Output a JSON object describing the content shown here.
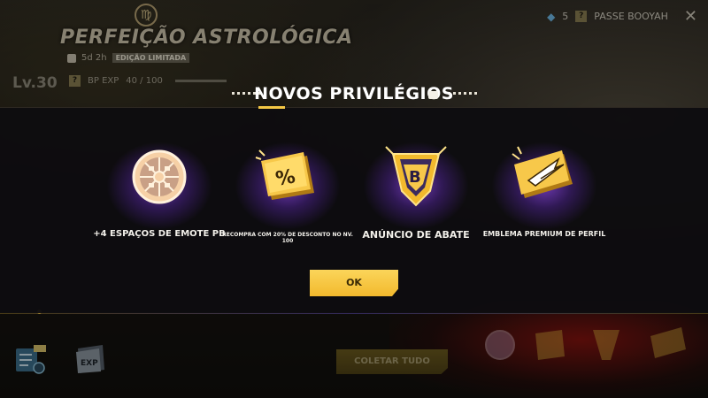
{
  "header": {
    "event_title": "PERFEIÇÃO ASTROLÓGICA",
    "zodiac_symbol": "♍",
    "timer": "5d 2h",
    "limited_tag": "EDIÇÃO LIMITADA",
    "level": "Lv.30",
    "bp_exp_label": "BP EXP",
    "bp_exp_value": "40 / 100",
    "question_badge": "?"
  },
  "top_right": {
    "diamond_count": "5",
    "pass_badge": "?",
    "pass_label": "PASSE BOOYAH",
    "close_glyph": "✕"
  },
  "modal": {
    "title": "NOVOS PRIVILÉGIOS",
    "rewards": [
      {
        "label": "+4 ESPAÇOS DE EMOTE PB",
        "icon": "emote-wheel-icon"
      },
      {
        "label": "RECOMPRA COM 20% DE DESCONTO NO NV. 100",
        "icon": "discount-ticket-icon"
      },
      {
        "label": "ANÚNCIO DE ABATE",
        "icon": "kill-announcement-badge-icon"
      },
      {
        "label": "EMBLEMA PREMIUM DE PERFIL",
        "icon": "premium-emblem-icon"
      }
    ],
    "ok_label": "OK"
  },
  "bottom": {
    "collect_all_label": "COLETAR TUDO",
    "exp_icon_text": "EXP"
  },
  "colors": {
    "accent_gold": "#f5c845",
    "glow_purple": "#8c46e6",
    "overlay": "#0e0c10"
  }
}
